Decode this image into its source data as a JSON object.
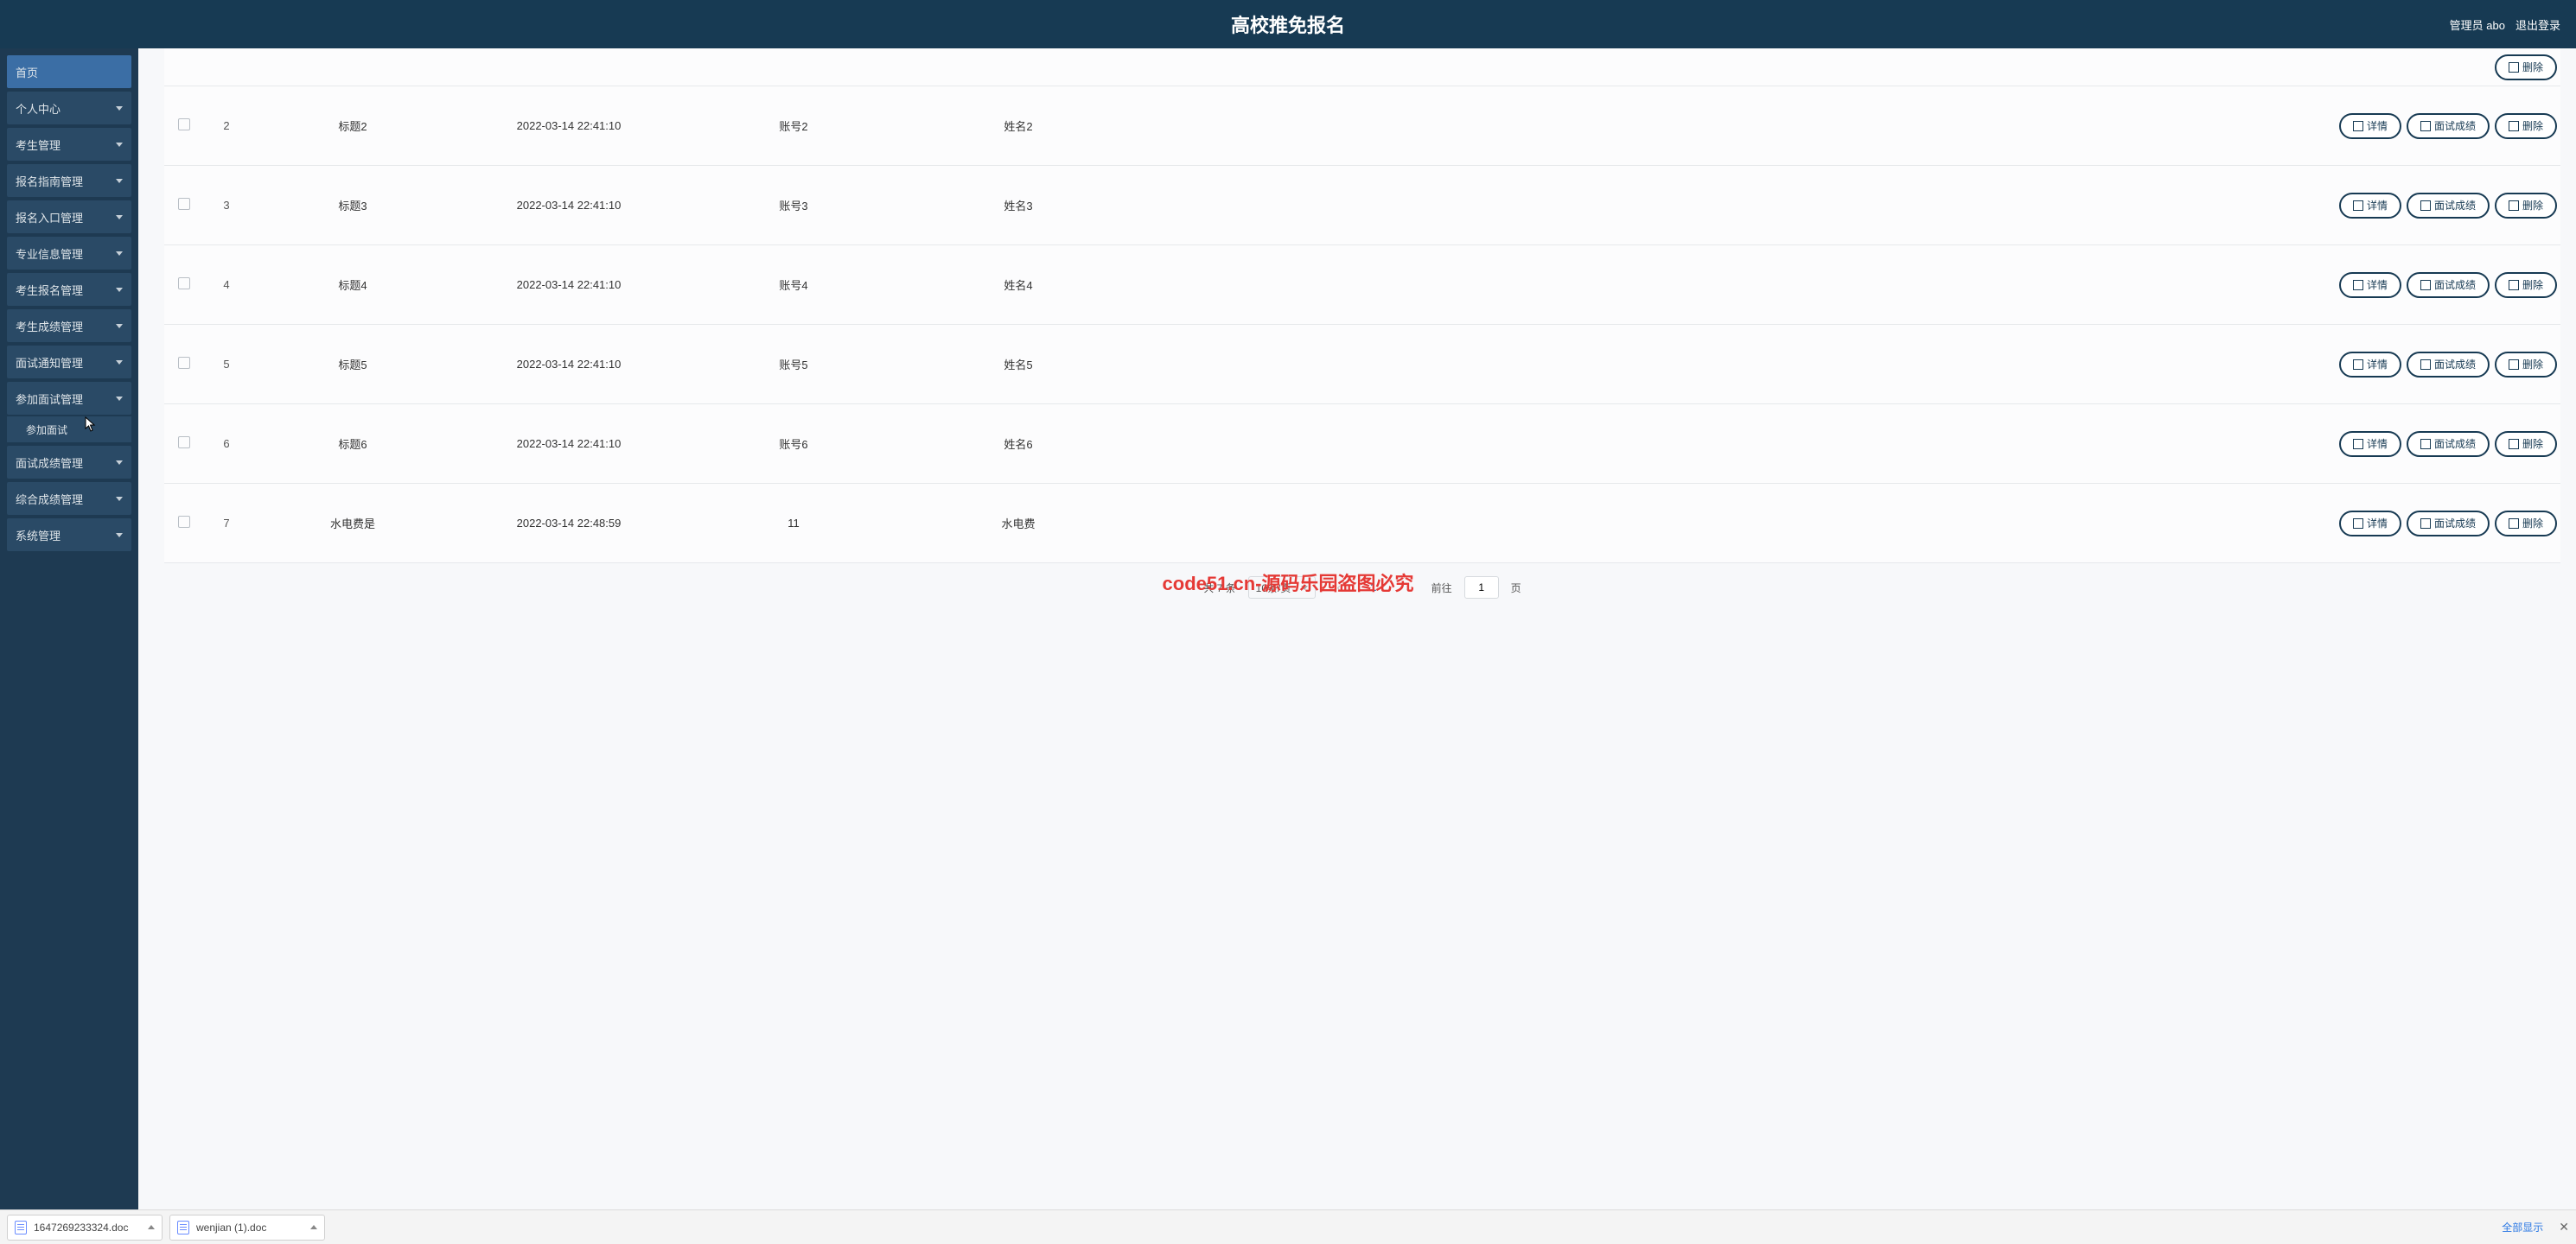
{
  "header": {
    "title": "高校推免报名",
    "admin_label": "管理员 abo",
    "logout_label": "退出登录"
  },
  "sidebar": {
    "items": [
      {
        "label": "首页",
        "home": true,
        "expandable": false
      },
      {
        "label": "个人中心",
        "home": false,
        "expandable": true
      },
      {
        "label": "考生管理",
        "home": false,
        "expandable": true
      },
      {
        "label": "报名指南管理",
        "home": false,
        "expandable": true
      },
      {
        "label": "报名入口管理",
        "home": false,
        "expandable": true
      },
      {
        "label": "专业信息管理",
        "home": false,
        "expandable": true
      },
      {
        "label": "考生报名管理",
        "home": false,
        "expandable": true
      },
      {
        "label": "考生成绩管理",
        "home": false,
        "expandable": true
      },
      {
        "label": "面试通知管理",
        "home": false,
        "expandable": true
      },
      {
        "label": "参加面试管理",
        "home": false,
        "expandable": true,
        "open": true,
        "children": [
          {
            "label": "参加面试"
          }
        ]
      },
      {
        "label": "面试成绩管理",
        "home": false,
        "expandable": true
      },
      {
        "label": "综合成绩管理",
        "home": false,
        "expandable": true
      },
      {
        "label": "系统管理",
        "home": false,
        "expandable": true
      }
    ]
  },
  "table": {
    "ops": {
      "detail": "详情",
      "score": "面试成绩",
      "delete": "删除"
    },
    "rows": [
      {
        "idx": "2",
        "title": "标题2",
        "date": "2022-03-14 22:41:10",
        "acct": "账号2",
        "name": "姓名2"
      },
      {
        "idx": "3",
        "title": "标题3",
        "date": "2022-03-14 22:41:10",
        "acct": "账号3",
        "name": "姓名3"
      },
      {
        "idx": "4",
        "title": "标题4",
        "date": "2022-03-14 22:41:10",
        "acct": "账号4",
        "name": "姓名4"
      },
      {
        "idx": "5",
        "title": "标题5",
        "date": "2022-03-14 22:41:10",
        "acct": "账号5",
        "name": "姓名5"
      },
      {
        "idx": "6",
        "title": "标题6",
        "date": "2022-03-14 22:41:10",
        "acct": "账号6",
        "name": "姓名6"
      },
      {
        "idx": "7",
        "title": "水电费是",
        "date": "2022-03-14 22:48:59",
        "acct": "11",
        "name": "水电费"
      }
    ]
  },
  "pager": {
    "total_label": "共 7 条",
    "page_size": "10条/页",
    "current": "1",
    "goto_prefix": "前往",
    "goto_value": "1",
    "goto_suffix": "页"
  },
  "downloads": {
    "files": [
      {
        "name": "1647269233324.doc"
      },
      {
        "name": "wenjian (1).doc"
      }
    ],
    "show_all": "全部显示"
  },
  "watermark": {
    "repeat": "code51.cn",
    "center": "code51.cn-源码乐园盗图必究"
  }
}
